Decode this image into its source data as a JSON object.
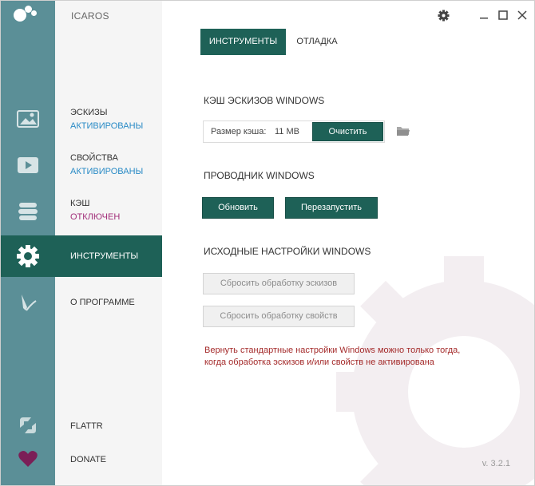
{
  "app": {
    "title": "ICAROS",
    "version": "v. 3.2.1"
  },
  "titlebar": {
    "settings_icon": "gear-icon",
    "minimize_icon": "minimize-icon",
    "maximize_icon": "maximize-icon",
    "close_icon": "close-icon"
  },
  "nav": {
    "items": [
      {
        "label": "ЭСКИЗЫ",
        "status": "АКТИВИРОВАНЫ",
        "icon": "image-icon"
      },
      {
        "label": "СВОЙСТВА",
        "status": "АКТИВИРОВАНЫ",
        "icon": "video-icon"
      },
      {
        "label": "КЭШ",
        "status": "ОТКЛЮЧЕН",
        "icon": "database-icon"
      },
      {
        "label": "ИНСТРУМЕНТЫ",
        "icon": "gear-icon"
      },
      {
        "label": "О ПРОГРАММЕ",
        "icon": "pen-icon"
      }
    ],
    "flattr": "FLATTR",
    "donate": "DONATE"
  },
  "tabs": {
    "active": "ИНСТРУМЕНТЫ",
    "other": "ОТЛАДКА"
  },
  "cache_section": {
    "title": "КЭШ ЭСКИЗОВ WINDOWS",
    "size_label": "Размер кэша:",
    "size_value": "11 MB",
    "clear_button": "Очистить"
  },
  "explorer_section": {
    "title": "ПРОВОДНИК WINDOWS",
    "refresh_button": "Обновить",
    "restart_button": "Перезапустить"
  },
  "defaults_section": {
    "title": "ИСХОДНЫЕ НАСТРОЙКИ WINDOWS",
    "reset_thumbs_button": "Сбросить обработку эскизов",
    "reset_props_button": "Сбросить обработку свойств",
    "warning": "Вернуть стандартные настройки Windows можно только тогда, когда обработка эскизов и/или свойств не активирована"
  },
  "colors": {
    "accent": "#1e6157",
    "sidebar": "#5b8f97",
    "link": "#2a8bc6",
    "disabled_status": "#a2307a",
    "warning": "#a42a2a"
  }
}
